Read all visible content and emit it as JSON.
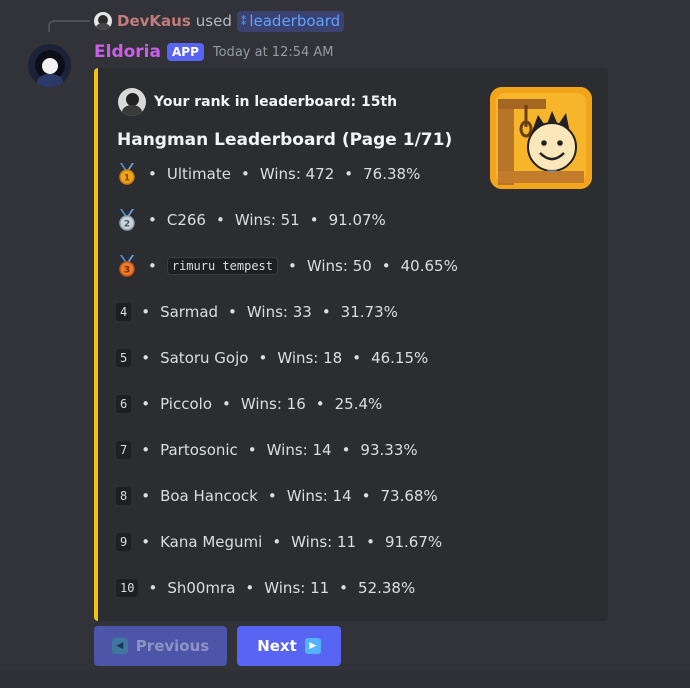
{
  "interaction": {
    "user": "DevKaus",
    "used_text": "used",
    "command": "leaderboard",
    "command_icon": "slash-command-icon"
  },
  "message": {
    "author": "Eldoria",
    "badge": "APP",
    "timestamp": "Today at 12:54 AM",
    "accent_color": "#f1c40f"
  },
  "embed": {
    "author_text": "Your rank in leaderboard: 15th",
    "title": "Hangman Leaderboard (Page 1/71)",
    "thumbnail_icon": "hangman-game-icon",
    "rows": [
      {
        "rank": "1",
        "name": "Ultimate",
        "wins": "Wins: 472",
        "pct": "76.38%",
        "medal": "gold"
      },
      {
        "rank": "2",
        "name": "C266",
        "wins": "Wins: 51",
        "pct": "91.07%",
        "medal": "silver"
      },
      {
        "rank": "3",
        "name": "rimuru tempest",
        "wins": "Wins: 50",
        "pct": "40.65%",
        "medal": "bronze"
      },
      {
        "rank": "4",
        "name": "Sarmad",
        "wins": "Wins: 33",
        "pct": "31.73%"
      },
      {
        "rank": "5",
        "name": "Satoru Gojo",
        "wins": "Wins: 18",
        "pct": "46.15%"
      },
      {
        "rank": "6",
        "name": "Piccolo",
        "wins": "Wins: 16",
        "pct": "25.4%"
      },
      {
        "rank": "7",
        "name": "Partosonic",
        "wins": "Wins: 14",
        "pct": "93.33%"
      },
      {
        "rank": "8",
        "name": "Boa Hancock",
        "wins": "Wins: 14",
        "pct": "73.68%"
      },
      {
        "rank": "9",
        "name": "Kana Megumi",
        "wins": "Wins: 11",
        "pct": "91.67%"
      },
      {
        "rank": "10",
        "name": "Sh00mra",
        "wins": "Wins: 11",
        "pct": "52.38%"
      }
    ],
    "separator": "•"
  },
  "buttons": {
    "previous": "Previous",
    "next": "Next",
    "previous_disabled": true
  }
}
